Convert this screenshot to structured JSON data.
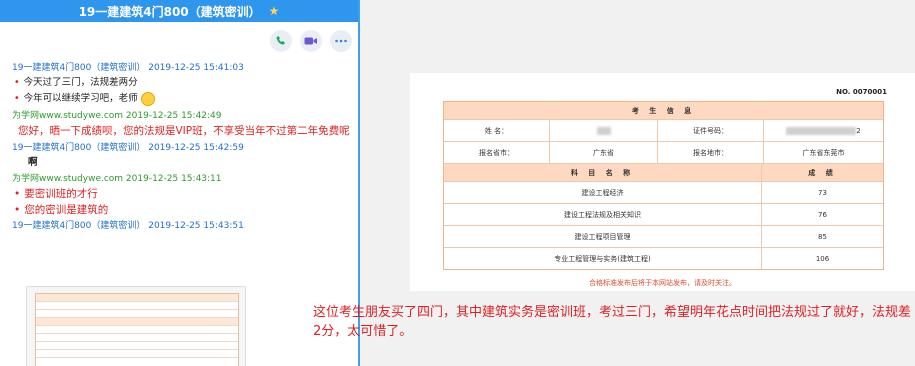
{
  "chat": {
    "title": "19一建建筑4门800（建筑密训）",
    "messages": [
      {
        "header": "19一建建筑4门800（建筑密训）  2019-12-25 15:41:03",
        "lines": [
          "今天过了三门，法规差两分",
          "今年可以继续学习吧，老师"
        ]
      },
      {
        "header": "为学网www.studywe.com 2019-12-25 15:42:49",
        "para": "您好，晒一下成绩呗，您的法规是VIP班，不享受当年不过第二年免费呢"
      },
      {
        "header": "19一建建筑4门800（建筑密训）  2019-12-25 15:42:59",
        "lines": [
          "啊"
        ]
      },
      {
        "header": "为学网www.studywe.com 2019-12-25 15:43:11",
        "lines": [
          "要密训班的才行",
          "您的密训是建筑的"
        ]
      },
      {
        "header": "19一建建筑4门800（建筑密训）  2019-12-25 15:43:51"
      }
    ]
  },
  "certificate": {
    "number": "NO. 0070001",
    "section_title": "考  生  信  息",
    "name_label": "姓      名：",
    "id_label": "证件号码：",
    "id_value_suffix": "2",
    "province_label": "报名省市：",
    "province_value": "广东省",
    "city_label": "报名地市：",
    "city_value": "广东省东莞市",
    "subject_header": "科  目  名  称",
    "score_header": "成    绩",
    "subjects": [
      {
        "name": "建设工程经济",
        "score": "73"
      },
      {
        "name": "建设工程法规及相关知识",
        "score": "76"
      },
      {
        "name": "建设工程项目管理",
        "score": "85"
      },
      {
        "name": "专业工程管理与实务(建筑工程)",
        "score": "106"
      }
    ],
    "notice": "合格标准发布后将于本网站发布，请及时关注。"
  },
  "caption": "这位考生朋友买了四门，其中建筑实务是密训班，考过三门，希望明年花点时间把法规过了就好，法规差2分，太可惜了。"
}
